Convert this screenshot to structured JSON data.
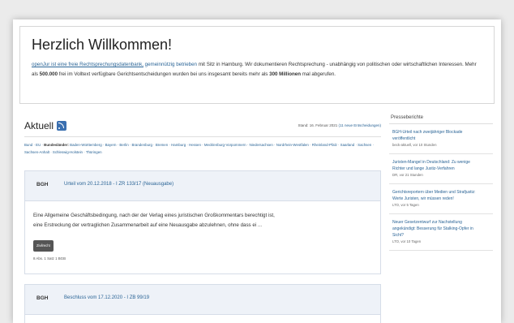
{
  "welcome": {
    "title": "Herzlich Willkommen!",
    "line1_link": "openJur ist eine freie Rechtsprechungsdatenbank,",
    "line1_link2": "gemeinnützig betrieben",
    "line1_rest": "mit Sitz in Hamburg. Wir dokumentieren Rechtsprechung - unabhängig von",
    "line2": "politischen oder wirtschaftlichen Interessen. Mehr als",
    "count_free": "500.000",
    "line2_rest": "frei im Volltext verfügbare Gerichtsentscheidungen wurden bei uns insgesamt bereits",
    "line3_pre": "mehr als",
    "count_views": "300 Millionen",
    "line3_rest": "mal abgerufen."
  },
  "aktuell": {
    "title": "Aktuell",
    "stand_label": "Stand: 16. Februar 2021",
    "stand_link": "(11 neue Entscheidungen)"
  },
  "laender": {
    "prefix": "Bund · EU ·",
    "label": "Bundesländer:",
    "list": "Baden-Württemberg · Bayern · Berlin · Brandenburg · Bremen · Hamburg · Hessen · Mecklenburg-Vorpommern ·",
    "list2": "Niedersachsen · Nordrhein-Westfalen · Rheinland-Pfalz · Saarland · Sachsen · Sachsen-Anhalt · Schleswig-Holstein · Thüringen"
  },
  "cards": [
    {
      "court": "BGH",
      "case": "Urteil vom 20.12.2018 - I ZR 133/17 (Neuausgabe)",
      "text1": "Eine Allgemeine Geschäftsbedingung, nach der der Verlag eines juristischen Großkommentars berechtigt ist,",
      "text2": "eine Erstreckung der vertraglichen Zusammenarbeit auf eine Neuausgabe abzulehnen, ohne dass ei ...",
      "tag": "Zivilrecht",
      "meta": "8 Abs. 1 Satz 1 BGB"
    },
    {
      "court": "BGH",
      "case": "Beschluss vom 17.12.2020 - I ZB 99/19"
    }
  ],
  "sidebar": {
    "title": "Presseberichte",
    "items": [
      {
        "title": "BGH-Urteil nach zweijähriger Blockade veröffentlicht",
        "sub": "beck-aktuell, vor 10 Stunden"
      },
      {
        "title": "Juristen-Mangel in Deutschland: Zu wenige Richter und lange Justiz-Verfahren",
        "sub": "DR, vor 21 Stunden"
      },
      {
        "title": "Gerichtsreportern über Medien und Strafjustiz: Werte Juristen, wir müssen reden!",
        "sub": "LTO, vor 5 Tagen"
      },
      {
        "title": "Neuer Gesetzentwurf zur Nachstellung angekündigt: Besserung für Stalking-Opfer in Sicht?",
        "sub": "LTO, vor 10 Tagen"
      }
    ]
  }
}
